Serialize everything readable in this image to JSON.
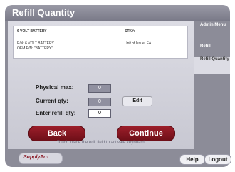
{
  "window": {
    "title": "Refill Quantity"
  },
  "item": {
    "name": "6 VOLT BATTERY",
    "stk_label": "STK#:",
    "pn_line": "P/N: 6 VOLT BATTERY",
    "oem_line": "OEM P/N: \"BATTERY\"",
    "uoi_label": "Unit of Issue: EA"
  },
  "form": {
    "physical_max_label": "Physical max:",
    "physical_max_value": "0",
    "current_qty_label": "Current qty:",
    "current_qty_value": "0",
    "refill_qty_label": "Enter refill qty:",
    "refill_qty_value": "0",
    "edit_label": "Edit"
  },
  "buttons": {
    "back": "Back",
    "continue": "Continue",
    "help": "Help",
    "logout": "Logout"
  },
  "hint": "Touch inside the edit field to activate keyboard",
  "sidebar": {
    "items": [
      {
        "label": "Admin Menu"
      },
      {
        "label": "Refill"
      },
      {
        "label": "Refill Quantity"
      }
    ]
  },
  "logo": {
    "text": "SupplyPro"
  }
}
